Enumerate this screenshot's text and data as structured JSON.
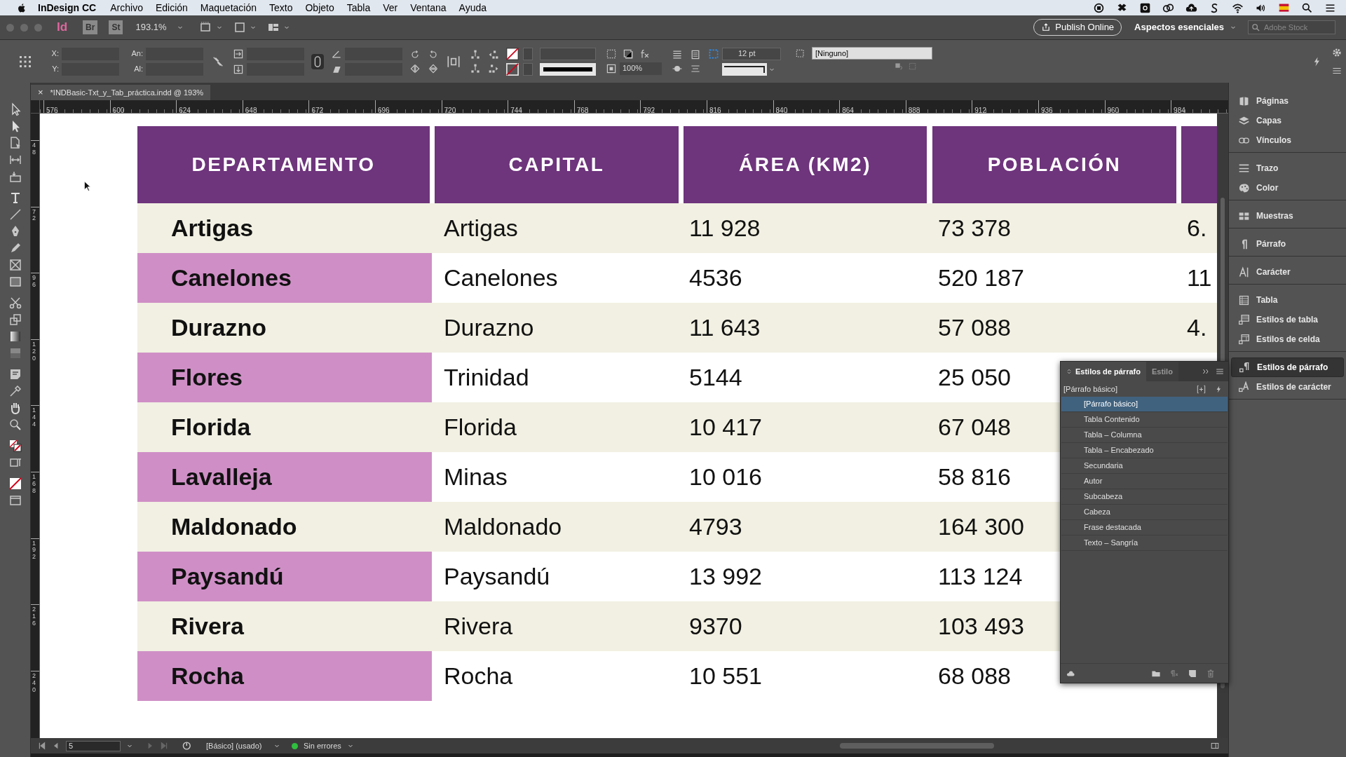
{
  "menu_bar": {
    "app": "InDesign CC",
    "items": [
      "Archivo",
      "Edición",
      "Maquetación",
      "Texto",
      "Objeto",
      "Tabla",
      "Ver",
      "Ventana",
      "Ayuda"
    ]
  },
  "app_bar": {
    "logo": "Id",
    "bridge": "Br",
    "stock": "St",
    "zoom": "193.1%",
    "publish": "Publish Online",
    "workspace": "Aspectos esenciales",
    "search_placeholder": "Adobe Stock"
  },
  "control_panel": {
    "x_label": "X:",
    "y_label": "Y:",
    "width_label": "An:",
    "height_label": "Al:",
    "scale": "100%",
    "stroke_weight": "12 pt",
    "object_style": "[Ninguno]"
  },
  "document_tab": {
    "close": "×",
    "title": "*INDBasic-Txt_y_Tab_práctica.indd @ 193%"
  },
  "ruler": {
    "horizontal": [
      "576",
      "600",
      "624",
      "648",
      "672",
      "696",
      "720",
      "744",
      "768",
      "792",
      "816",
      "840",
      "864",
      "888",
      "912",
      "936",
      "960",
      "984"
    ],
    "vertical": [
      "48",
      "72",
      "96",
      "120",
      "144",
      "168",
      "192",
      "216",
      "240"
    ]
  },
  "table": {
    "columns": [
      "DEPARTAMENTO",
      "CAPITAL",
      "ÁREA (KM2)",
      "POBLACIÓN"
    ],
    "rows": [
      {
        "cells": [
          "Artigas",
          "Artigas",
          "11 928",
          "73 378",
          "6."
        ]
      },
      {
        "cells": [
          "Canelones",
          "Canelones",
          "4536",
          "520 187",
          "11"
        ]
      },
      {
        "cells": [
          "Durazno",
          "Durazno",
          "11 643",
          "57 088",
          "4."
        ]
      },
      {
        "cells": [
          "Flores",
          "Trinidad",
          "5144",
          "25 050"
        ]
      },
      {
        "cells": [
          "Florida",
          "Florida",
          "10 417",
          "67 048"
        ]
      },
      {
        "cells": [
          "Lavalleja",
          "Minas",
          "10 016",
          "58 816"
        ]
      },
      {
        "cells": [
          "Maldonado",
          "Maldonado",
          "4793",
          "164 300"
        ]
      },
      {
        "cells": [
          "Paysandú",
          "Paysandú",
          "13 992",
          "113 124"
        ]
      },
      {
        "cells": [
          "Rivera",
          "Rivera",
          "9370",
          "103 493"
        ]
      },
      {
        "cells": [
          "Rocha",
          "Rocha",
          "10 551",
          "68 088"
        ]
      }
    ]
  },
  "dock": {
    "groups": [
      [
        {
          "label": "Páginas",
          "selected": false
        },
        {
          "label": "Capas",
          "selected": false
        },
        {
          "label": "Vínculos",
          "selected": false
        }
      ],
      [
        {
          "label": "Trazo",
          "selected": false
        },
        {
          "label": "Color",
          "selected": false
        }
      ],
      [
        {
          "label": "Muestras",
          "selected": false
        }
      ],
      [
        {
          "label": "Párrafo",
          "selected": false
        }
      ],
      [
        {
          "label": "Carácter",
          "selected": false
        }
      ],
      [
        {
          "label": "Tabla",
          "selected": false
        },
        {
          "label": "Estilos de tabla",
          "selected": false
        },
        {
          "label": "Estilos de celda",
          "selected": false
        }
      ],
      [
        {
          "label": "Estilos de párrafo",
          "selected": true
        },
        {
          "label": "Estilos de carácter",
          "selected": false
        }
      ]
    ]
  },
  "styles_panel": {
    "tabs": [
      {
        "label": "Estilos de párrafo",
        "selected": true
      },
      {
        "label": "Estilo",
        "selected": false
      }
    ],
    "current": "[Párrafo básico]",
    "items": [
      {
        "label": "[Párrafo básico]",
        "selected": true
      },
      {
        "label": "Tabla Contenido",
        "selected": false
      },
      {
        "label": "Tabla – Columna",
        "selected": false
      },
      {
        "label": "Tabla – Encabezado",
        "selected": false
      },
      {
        "label": "Secundaria",
        "selected": false
      },
      {
        "label": "Autor",
        "selected": false
      },
      {
        "label": "Subcabeza",
        "selected": false
      },
      {
        "label": "Cabeza",
        "selected": false
      },
      {
        "label": "Frase destacada",
        "selected": false
      },
      {
        "label": "Texto – Sangría",
        "selected": false
      }
    ]
  },
  "status_bar": {
    "page": "5",
    "profile": "[Básico] (usado)",
    "preflight": "Sin errores"
  }
}
